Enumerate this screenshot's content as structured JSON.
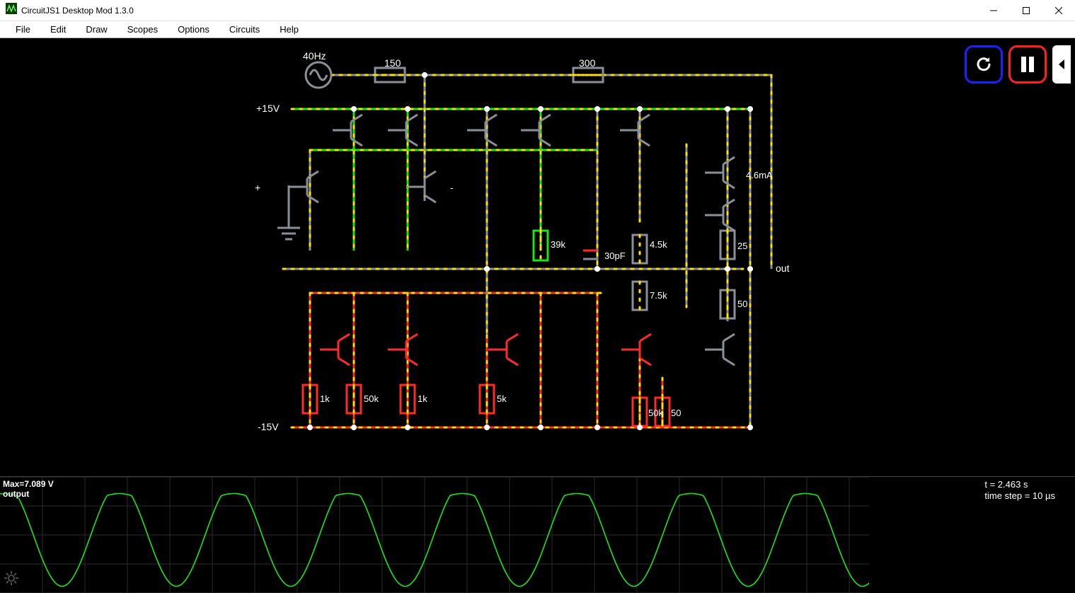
{
  "window": {
    "title": "CircuitJS1 Desktop Mod 1.3.0"
  },
  "menu": {
    "items": [
      "File",
      "Edit",
      "Draw",
      "Scopes",
      "Options",
      "Circuits",
      "Help"
    ]
  },
  "controls": {
    "reset_name": "reset",
    "pause_name": "pause",
    "speed_name": "speed-collapse"
  },
  "circuit": {
    "source_freq": "40Hz",
    "pos_rail": "+15V",
    "neg_rail": "-15V",
    "in_plus": "+",
    "in_minus": "-",
    "out_label": "out",
    "current_readout": "4.6mA",
    "cap_label": "30pF",
    "resistors": {
      "r_top_a": "150",
      "r_top_b": "300",
      "r_39k": "39k",
      "r_4_5k": "4.5k",
      "r_7_5k": "7.5k",
      "r_25": "25",
      "r_50a": "50",
      "r_1k_a": "1k",
      "r_50k_a": "50k",
      "r_1k_b": "1k",
      "r_5k": "5k",
      "r_50k_b": "50k",
      "r_50b": "50"
    }
  },
  "scope": {
    "max_label": "Max=7.089 V",
    "channel_label": "output"
  },
  "status": {
    "time": "t = 2.463 s",
    "step": "time step = 10 µs"
  },
  "chart_data": {
    "type": "line",
    "title": "output",
    "ylabel": "V",
    "ylim": [
      -7.089,
      7.089
    ],
    "xlabel": "t",
    "series": [
      {
        "name": "output",
        "approx_amplitude_V": 7.089,
        "approx_freq_Hz": 40,
        "shape": "sine-with-soft-clip-top"
      }
    ],
    "annotations": [
      "Max=7.089 V"
    ]
  }
}
